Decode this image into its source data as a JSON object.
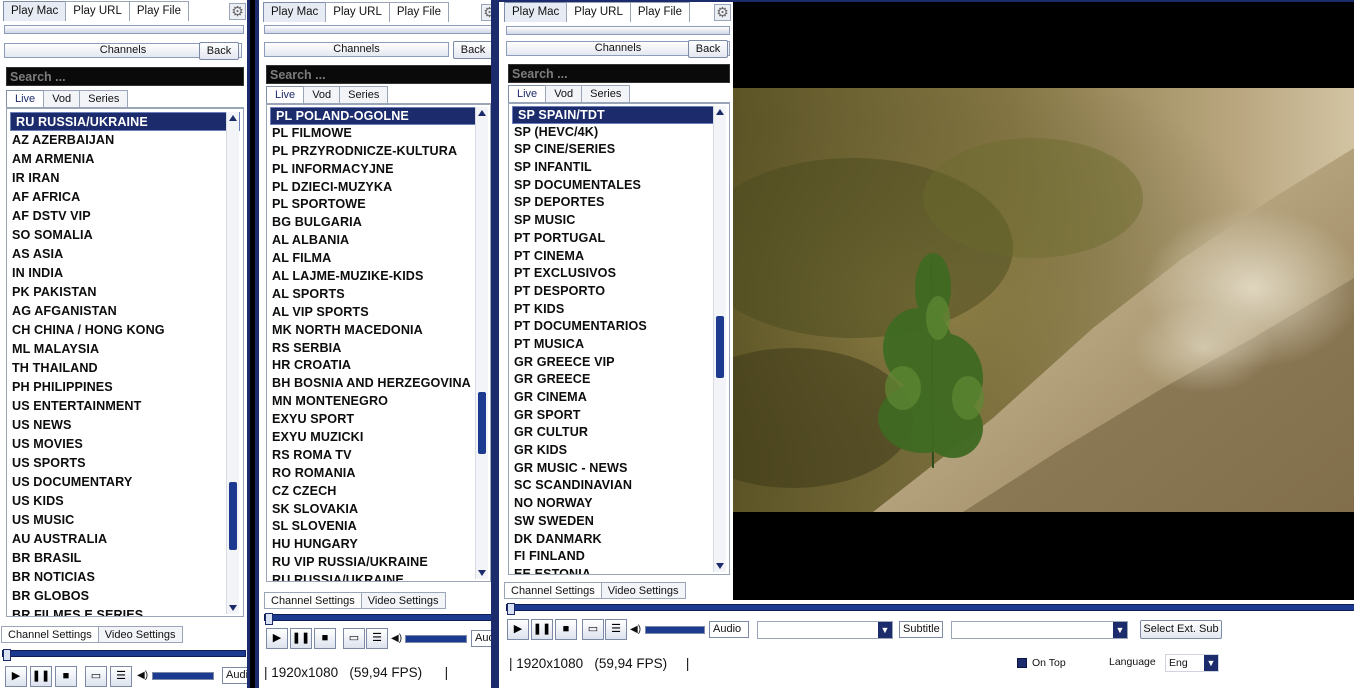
{
  "w1": {
    "tabs": [
      "Play Mac",
      "Play URL",
      "Play File"
    ],
    "channels_label": "Channels",
    "back_label": "Back",
    "search_placeholder": "Search ...",
    "subtabs": [
      "Live",
      "Vod",
      "Series"
    ],
    "items": [
      "RU RUSSIA/UKRAINE",
      "AZ AZERBAIJAN",
      "AM ARMENIA",
      "IR IRAN",
      "AF AFRICA",
      "AF DSTV VIP",
      "SO SOMALIA",
      "AS ASIA",
      "IN INDIA",
      "PK PAKISTAN",
      "AG AFGANISTAN",
      "CH CHINA / HONG KONG",
      "ML MALAYSIA",
      "TH THAILAND",
      "PH PHILIPPINES",
      "US ENTERTAINMENT",
      "US NEWS",
      "US MOVIES",
      "US SPORTS",
      "US DOCUMENTARY",
      "US KIDS",
      "US MUSIC",
      "AU AUSTRALIA",
      "BR BRASIL",
      "BR NOTICIAS",
      "BR  GLOBOS",
      "BR FILMES E SERIES"
    ],
    "bottom_tabs": [
      "Channel Settings",
      "Video Settings"
    ],
    "audio_label": "Audio"
  },
  "w2": {
    "tabs": [
      "Play Mac",
      "Play URL",
      "Play File"
    ],
    "channels_label": "Channels",
    "back_label": "Back",
    "search_placeholder": "Search ...",
    "subtabs": [
      "Live",
      "Vod",
      "Series"
    ],
    "items": [
      "PL POLAND-OGOLNE",
      "PL FILMOWE",
      "PL PRZYRODNICZE-KULTURA",
      "PL INFORMACYJNE",
      "PL DZIECI-MUZYKA",
      "PL SPORTOWE",
      "BG BULGARIA",
      "AL ALBANIA",
      "AL FILMA",
      "AL LAJME-MUZIKE-KIDS",
      "AL SPORTS",
      "AL VIP SPORTS",
      "MK NORTH MACEDONIA",
      "RS SERBIA",
      "HR CROATIA",
      "BH BOSNIA AND HERZEGOVINA",
      "MN MONTENEGRO",
      "EXYU SPORT",
      "EXYU MUZICKI",
      "RS ROMA TV",
      "RO ROMANIA",
      "CZ CZECH",
      "SK SLOVAKIA",
      "SL SLOVENIA",
      "HU HUNGARY",
      "RU VIP RUSSIA/UKRAINE",
      "RU RUSSIA/UKRAINE"
    ],
    "bottom_tabs": [
      "Channel Settings",
      "Video Settings"
    ],
    "audio_label": "Audio",
    "resolution": "1920x1080",
    "fps": "(59,94 FPS)"
  },
  "w3": {
    "tabs": [
      "Play Mac",
      "Play URL",
      "Play File"
    ],
    "channels_label": "Channels",
    "back_label": "Back",
    "search_placeholder": "Search ...",
    "subtabs": [
      "Live",
      "Vod",
      "Series"
    ],
    "items": [
      "SP SPAIN/TDT",
      "SP (HEVC/4K)",
      "SP CINE/SERIES",
      "SP INFANTIL",
      "SP DOCUMENTALES",
      "SP DEPORTES",
      "SP MUSIC",
      "PT PORTUGAL",
      "PT CINEMA",
      "PT EXCLUSIVOS",
      "PT DESPORTO",
      "PT KIDS",
      "PT DOCUMENTARIOS",
      "PT MUSICA",
      "GR GREECE VIP",
      "GR GREECE",
      "GR CINEMA",
      "GR SPORT",
      "GR CULTUR",
      "GR KIDS",
      "GR MUSIC - NEWS",
      "SC SCANDINAVIAN",
      "NO NORWAY",
      "SW SWEDEN",
      "DK DANMARK",
      "FI FINLAND",
      "EE ESTONIA"
    ],
    "bottom_tabs": [
      "Channel Settings",
      "Video Settings"
    ],
    "audio_label": "Audio",
    "subtitle_label": "Subtitle",
    "select_ext_sub": "Select Ext. Sub",
    "resolution": "1920x1080",
    "fps": "(59,94 FPS)",
    "on_top_label": "On Top",
    "language_label": "Language",
    "language_value": "Eng"
  },
  "icons": {
    "gear": "gear-icon",
    "play": "play-icon",
    "pause": "pause-icon",
    "stop": "stop-icon",
    "screen": "screen-icon",
    "playlist": "playlist-icon",
    "volume": "volume-icon"
  },
  "colors": {
    "accent": "#1c2b6b",
    "thumb": "#1c3a8f",
    "search_bg": "#0a0a0a"
  }
}
